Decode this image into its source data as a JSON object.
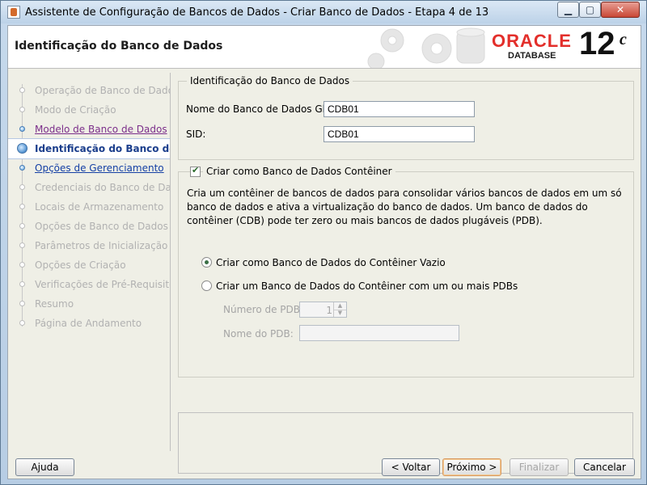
{
  "window": {
    "title": "Assistente de Configuração de Bancos de Dados - Criar Banco de Dados - Etapa 4 de 13",
    "minimize_label": "▁",
    "maximize_label": "▢",
    "close_label": "✕"
  },
  "header": {
    "page_title": "Identificação do Banco de Dados",
    "oracle_logo": "ORACLE",
    "database_logo": "DATABASE",
    "version": "12",
    "version_suffix": "c"
  },
  "sidebar": {
    "steps": [
      {
        "label": "Operação de Banco de Dados",
        "state": "disabled"
      },
      {
        "label": "Modo de Criação",
        "state": "disabled"
      },
      {
        "label": "Modelo de Banco de Dados",
        "state": "visited"
      },
      {
        "label": "Identificação do Banco de Dados",
        "state": "current"
      },
      {
        "label": "Opções de Gerenciamento",
        "state": "link"
      },
      {
        "label": "Credenciais do Banco de Dados",
        "state": "disabled"
      },
      {
        "label": "Locais de Armazenamento",
        "state": "disabled"
      },
      {
        "label": "Opções de Banco de Dados",
        "state": "disabled"
      },
      {
        "label": "Parâmetros de Inicialização",
        "state": "disabled"
      },
      {
        "label": "Opções de Criação",
        "state": "disabled"
      },
      {
        "label": "Verificações de Pré-Requisito",
        "state": "disabled"
      },
      {
        "label": "Resumo",
        "state": "disabled"
      },
      {
        "label": "Página de Andamento",
        "state": "disabled"
      }
    ],
    "scroll_left_icon": "◀",
    "scroll_right_icon": "▶"
  },
  "identification": {
    "group_title": "Identificação do Banco de Dados",
    "global_name_label": "Nome do Banco de Dados Global:",
    "global_name_value": "CDB01",
    "sid_label": "SID:",
    "sid_value": "CDB01"
  },
  "container": {
    "checkbox_label": "Criar como Banco de Dados Contêiner",
    "checkbox_checked": true,
    "description": "Cria um contêiner de bancos de dados para consolidar vários bancos de dados em um só banco de dados e ativa a virtualização do banco de dados. Um banco de dados do contêiner (CDB) pode ter zero ou mais bancos de dados plugáveis (PDB).",
    "radio_empty_label": "Criar como Banco de Dados do Contêiner Vazio",
    "radio_empty_selected": true,
    "radio_pdbs_label": "Criar um Banco de Dados do Contêiner com um ou mais PDBs",
    "num_pdbs_label": "Número de PDBs:",
    "num_pdbs_value": "1",
    "pdb_name_label": "Nome do PDB:",
    "pdb_name_value": ""
  },
  "footer": {
    "help": "Ajuda",
    "back": "< Voltar",
    "next": "Próximo >",
    "finish": "Finalizar",
    "cancel": "Cancelar"
  },
  "colors": {
    "oracle_red": "#e32f2b",
    "current_step": "#1b3e8c",
    "visited_step": "#7b2e8a"
  }
}
